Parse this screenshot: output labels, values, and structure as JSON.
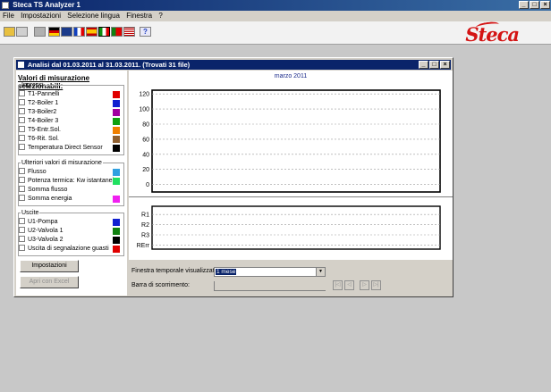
{
  "app": {
    "title": "Steca TS Analyzer 1",
    "window_buttons": [
      "_",
      "□",
      "×"
    ]
  },
  "menu": [
    "File",
    "Impostazioni",
    "Selezione lingua",
    "Finestra",
    "?"
  ],
  "toolbar": {
    "help_glyph": "?"
  },
  "brand": {
    "logo_text": "Steca",
    "color": "#d41414"
  },
  "analysis_window": {
    "title": "Analisi dal 01.03.2011 al 31.03.2011. (Trovati 31 file)",
    "window_buttons": [
      "_",
      "□",
      "×"
    ]
  },
  "left_panel": {
    "heading": "Valori di misurazione selezionabili:",
    "groups": [
      {
        "legend": "Ingressi",
        "items": [
          {
            "label": "T1-Pannelli",
            "color": "#e00000"
          },
          {
            "label": "T2-Boiler 1",
            "color": "#1020d0"
          },
          {
            "label": "T3-Boiler2",
            "color": "#a000a0"
          },
          {
            "label": "T4-Boiler 3",
            "color": "#10a010"
          },
          {
            "label": "T5-Entr.Sol.",
            "color": "#f08000"
          },
          {
            "label": "T6-Rit. Sol.",
            "color": "#906030"
          },
          {
            "label": "Temperatura Direct Sensor",
            "color": "#000000"
          }
        ]
      },
      {
        "legend": "Ulteriori valori di misurazione",
        "items": [
          {
            "label": "Flusso",
            "color": "#30a0e0"
          },
          {
            "label": "Potenza termica: Kw istantanei",
            "color": "#20e060"
          },
          {
            "label": "Somma flusso",
            "color": "#ffffff"
          },
          {
            "label": "Somma energia",
            "color": "#f020f0"
          }
        ]
      },
      {
        "legend": "Uscite",
        "items": [
          {
            "label": "U1-Pompa",
            "color": "#1020d0"
          },
          {
            "label": "U2-Valvola 1",
            "color": "#108010"
          },
          {
            "label": "U3-Valvola 2",
            "color": "#000000"
          },
          {
            "label": "Uscita di segnalazione guasti",
            "color": "#e00000"
          }
        ]
      }
    ],
    "buttons": {
      "settings": "Impostazioni",
      "excel": "Apri con Excel"
    }
  },
  "chart_data": [
    {
      "type": "line",
      "title": "marzo 2011",
      "xlabel": "",
      "ylabel": "",
      "ylim": [
        -10,
        125
      ],
      "yticks": [
        "120",
        "100",
        "80",
        "60",
        "40",
        "20",
        "0"
      ],
      "grid": true,
      "series": []
    },
    {
      "type": "line",
      "title": "",
      "categories": [
        "R1",
        "R2",
        "R3",
        "RErr"
      ],
      "grid": true,
      "series": []
    }
  ],
  "controls": {
    "window_label": "Finestra temporale visualizzata:",
    "window_value": "1 mese",
    "scroll_label": "Barra di scorrimento:",
    "nav": [
      "|◁",
      "◁",
      "▷",
      "▷|"
    ]
  }
}
